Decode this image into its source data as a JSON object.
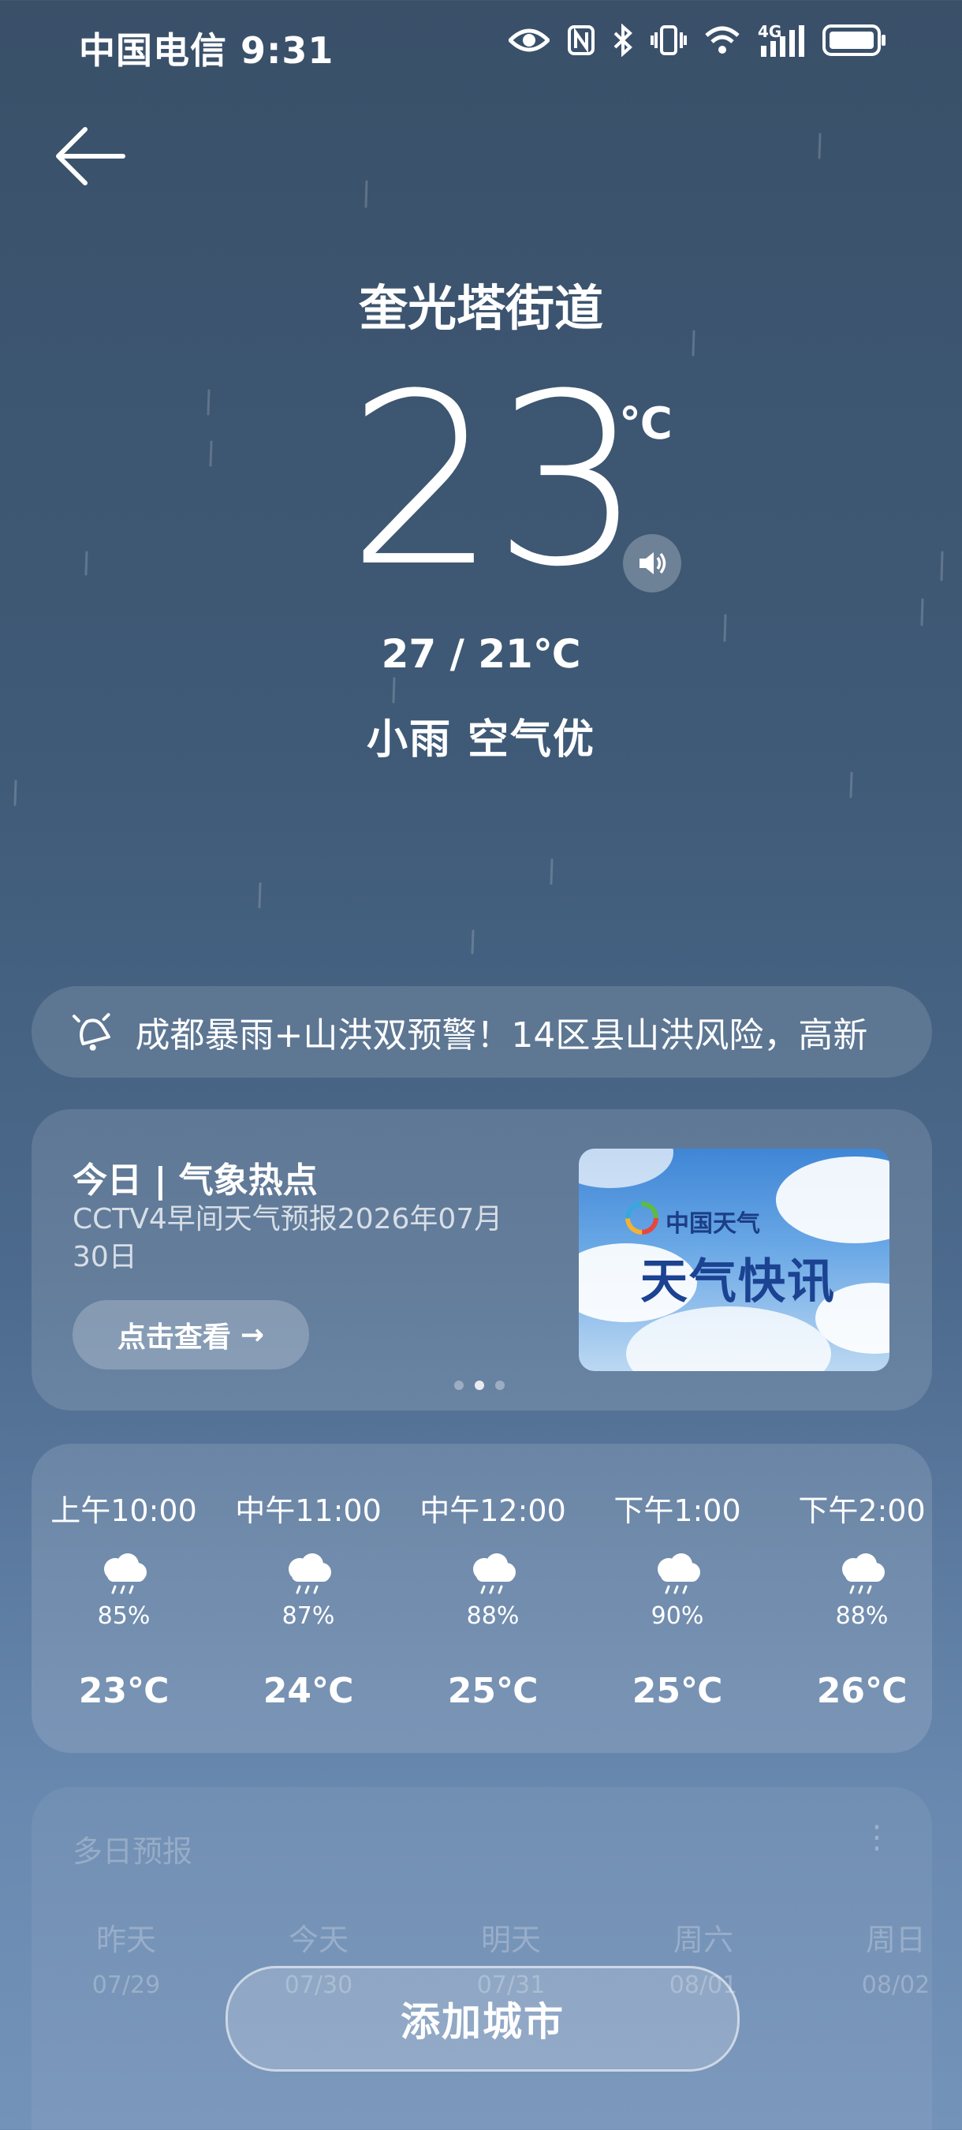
{
  "status_bar": {
    "carrier_time": "中国电信 9:31",
    "icons": [
      "eye-icon",
      "nfc-icon",
      "bluetooth-icon",
      "vibrate-icon",
      "wifi-icon",
      "signal-4g-icon",
      "battery-icon"
    ],
    "network_label": "4G"
  },
  "header": {
    "location": "奎光塔街道"
  },
  "current": {
    "temperature": "23",
    "unit": "℃",
    "range": "27 / 21℃",
    "condition": "小雨  空气优"
  },
  "alert": {
    "text": "成都暴雨+山洪双预警！14区县山洪风险，高新"
  },
  "news": {
    "title": "今日 | 气象热点",
    "subtitle": "CCTV4早间天气预报2026年07月30日",
    "button_label": "点击查看",
    "button_arrow": "→",
    "page_count": 3,
    "active_page": 2,
    "thumbnail": {
      "brand": "中国天气",
      "title": "天气快讯"
    }
  },
  "hourly": [
    {
      "time": "上午10:00",
      "precip": "85%",
      "temp": "23℃",
      "icon": "rain-cloud-icon"
    },
    {
      "time": "中午11:00",
      "precip": "87%",
      "temp": "24℃",
      "icon": "rain-cloud-icon"
    },
    {
      "time": "中午12:00",
      "precip": "88%",
      "temp": "25℃",
      "icon": "rain-cloud-icon"
    },
    {
      "time": "下午1:00",
      "precip": "90%",
      "temp": "25℃",
      "icon": "rain-cloud-icon"
    },
    {
      "time": "下午2:00",
      "precip": "88%",
      "temp": "26℃",
      "icon": "rain-cloud-icon"
    }
  ],
  "multi_day": {
    "title": "多日预报",
    "more": "⋮",
    "days": [
      {
        "name": "昨天",
        "date": "07/29"
      },
      {
        "name": "今天",
        "date": "07/30"
      },
      {
        "name": "明天",
        "date": "07/31"
      },
      {
        "name": "周六",
        "date": "08/01"
      },
      {
        "name": "周日",
        "date": "08/02"
      }
    ]
  },
  "add_city": {
    "label": "添加城市"
  }
}
